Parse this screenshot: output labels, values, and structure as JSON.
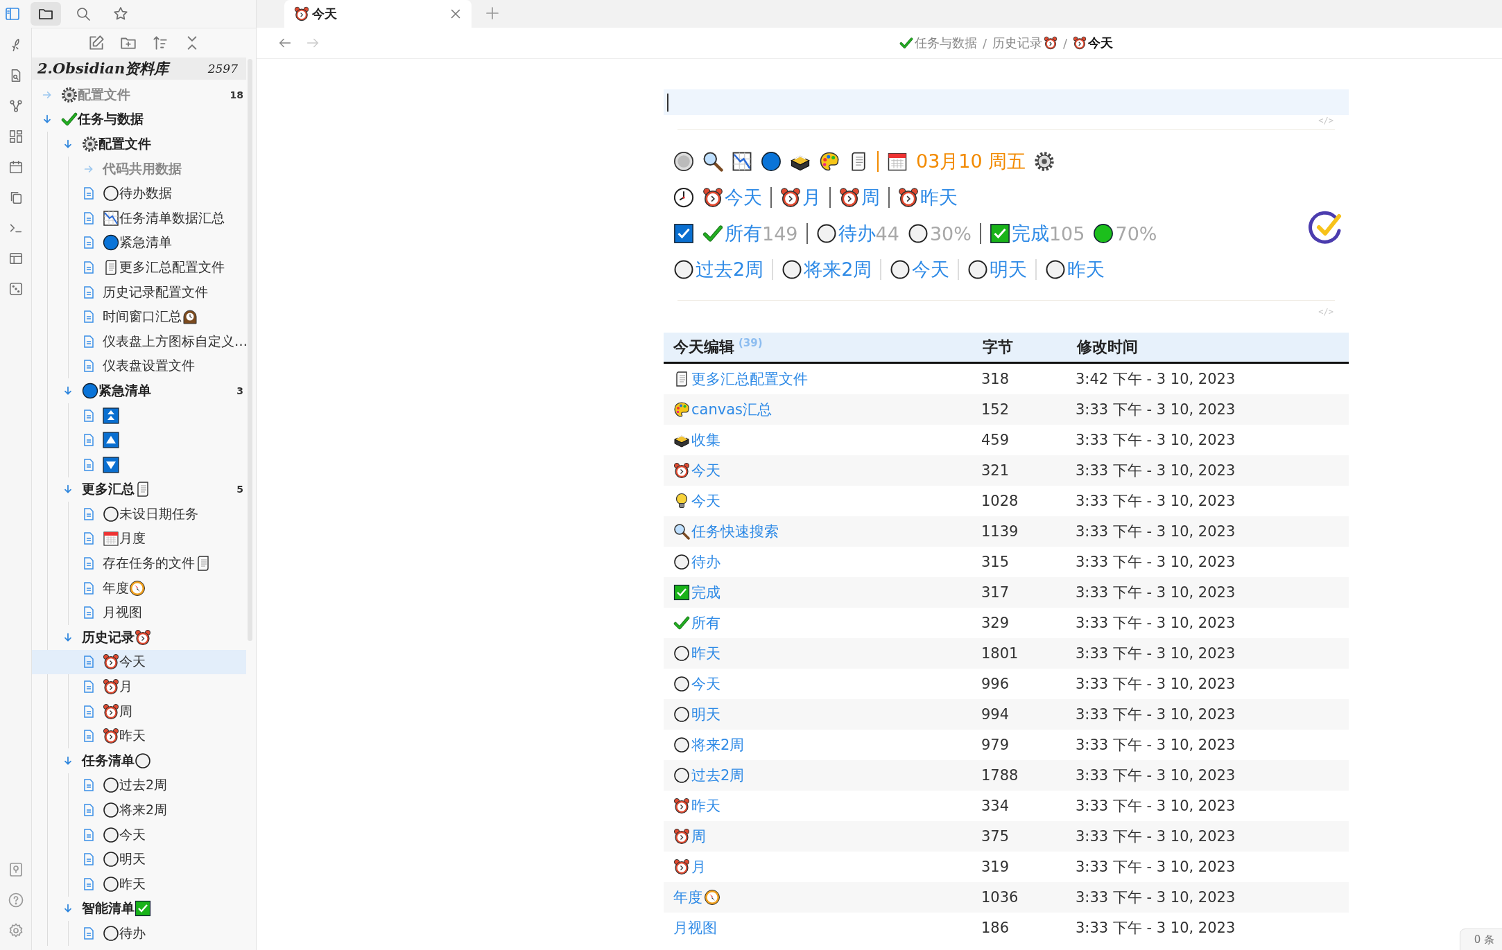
{
  "sidebar_tabs": [
    {
      "kind": "folder",
      "selected": true
    },
    {
      "kind": "search",
      "selected": false
    },
    {
      "kind": "star",
      "selected": false
    }
  ],
  "vault": {
    "name": "2.Obsidian资料库",
    "count": "2597"
  },
  "tree": [
    {
      "kind": "gear",
      "text": "配置文件",
      "count": "18",
      "expanded": false,
      "dimmed": true,
      "selected": false
    },
    {
      "kind": "check",
      "text": "任务与数据",
      "expanded": true,
      "dimmed": false,
      "selected": false,
      "children": [
        {
          "kind": "gear",
          "text": "配置文件",
          "expanded": true,
          "dimmed": false,
          "selected": false,
          "children": [
            {
              "kind": "plain",
              "text": "代码共用数据",
              "expanded": false,
              "dimmed": true,
              "selected": false
            },
            {
              "kind": "circle",
              "text": "待办数据",
              "selected": false
            },
            {
              "kind": "chart",
              "text": "任务清单数据汇总",
              "selected": false
            },
            {
              "kind": "bluedot",
              "text": "紧急清单",
              "selected": false
            },
            {
              "kind": "scroll",
              "text": "更多汇总配置文件",
              "selected": false
            },
            {
              "kind": "plain",
              "text": "历史记录配置文件",
              "selected": false
            },
            {
              "kind": "mantel_after",
              "text": "时间窗口汇总",
              "selected": false
            },
            {
              "kind": "plain",
              "text": "仪表盘上方图标自定义…",
              "selected": false
            },
            {
              "kind": "plain",
              "text": "仪表盘设置文件",
              "selected": false
            }
          ]
        },
        {
          "kind": "bluedot",
          "text": "紧急清单",
          "count": "3",
          "expanded": true,
          "dimmed": false,
          "selected": false,
          "children": [
            {
              "kind": "up2",
              "selected": false
            },
            {
              "kind": "up",
              "selected": false
            },
            {
              "kind": "down",
              "selected": false
            }
          ]
        },
        {
          "kind": "scroll_after",
          "text": "更多汇总",
          "count": "5",
          "expanded": true,
          "dimmed": false,
          "selected": false,
          "children": [
            {
              "kind": "circle",
              "text": "未设日期任务",
              "selected": false
            },
            {
              "kind": "calendar",
              "text": "月度",
              "selected": false
            },
            {
              "kind": "scroll_after",
              "text": "存在任务的文件",
              "selected": false
            },
            {
              "kind": "compass_after",
              "text": "年度",
              "selected": false
            },
            {
              "kind": "plain",
              "text": "月视图",
              "selected": false
            }
          ]
        },
        {
          "kind": "alarm_after",
          "text": "历史记录",
          "expanded": true,
          "dimmed": false,
          "selected": false,
          "children": [
            {
              "kind": "alarm",
              "text": "今天",
              "selected": true
            },
            {
              "kind": "alarm",
              "text": "月",
              "selected": false
            },
            {
              "kind": "alarm",
              "text": "周",
              "selected": false
            },
            {
              "kind": "alarm",
              "text": "昨天",
              "selected": false
            }
          ]
        },
        {
          "kind": "circle_after",
          "text": "任务清单",
          "expanded": true,
          "dimmed": false,
          "selected": false,
          "children": [
            {
              "kind": "circle",
              "text": "过去2周",
              "selected": false
            },
            {
              "kind": "circle",
              "text": "将来2周",
              "selected": false
            },
            {
              "kind": "circle",
              "text": "今天",
              "selected": false
            },
            {
              "kind": "circle",
              "text": "明天",
              "selected": false
            },
            {
              "kind": "circle",
              "text": "昨天",
              "selected": false
            }
          ]
        },
        {
          "kind": "greenbox_after",
          "text": "智能清单",
          "expanded": true,
          "dimmed": false,
          "selected": false,
          "children": [
            {
              "kind": "circle",
              "text": "待办",
              "selected": false
            }
          ]
        }
      ]
    }
  ],
  "tab": {
    "kind": "alarm",
    "title": "今天",
    "selected": true
  },
  "breadcrumb": [
    {
      "kind": "check",
      "text": "任务与数据",
      "current": false
    },
    {
      "kind": "sep",
      "text": "/"
    },
    {
      "kind": "alarm_after",
      "text": "历史记录",
      "current": false
    },
    {
      "kind": "sep",
      "text": "/"
    },
    {
      "kind": "alarm",
      "text": "今天",
      "current": true
    }
  ],
  "input_block": {
    "end_mark": "</>"
  },
  "dashboard": {
    "rows": [
      {
        "items": [
          {
            "kind": "circlegrey"
          },
          {
            "kind": "search"
          },
          {
            "kind": "chart"
          },
          {
            "kind": "bluedot"
          },
          {
            "kind": "inbox"
          },
          {
            "kind": "palette"
          },
          {
            "kind": "scroll"
          },
          {
            "kind": "sep"
          },
          {
            "kind": "calendar"
          },
          {
            "kind": "date",
            "text": "03月10 周五"
          },
          {
            "kind": "gear"
          }
        ]
      },
      {
        "items": [
          {
            "kind": "clock"
          },
          {
            "kind": "alarm",
            "text": "今天"
          },
          {
            "kind": "sep"
          },
          {
            "kind": "alarm",
            "text": "月"
          },
          {
            "kind": "sep"
          },
          {
            "kind": "alarm",
            "text": "周"
          },
          {
            "kind": "sep"
          },
          {
            "kind": "alarm",
            "text": "昨天"
          }
        ]
      },
      {
        "items": [
          {
            "kind": "bluebox"
          },
          {
            "kind": "check",
            "text": "所有",
            "count": "149"
          },
          {
            "kind": "sep"
          },
          {
            "kind": "circle",
            "text": "待办",
            "count": "44"
          },
          {
            "kind": "circle",
            "value": "30%"
          },
          {
            "kind": "sep"
          },
          {
            "kind": "greenbox",
            "text": "完成",
            "count": "105"
          },
          {
            "kind": "greendot",
            "value": "70%"
          }
        ]
      },
      {
        "items": [
          {
            "kind": "circle",
            "text": "过去2周"
          },
          {
            "kind": "sep"
          },
          {
            "kind": "circle",
            "text": "将来2周"
          },
          {
            "kind": "sep"
          },
          {
            "kind": "circle",
            "text": "今天"
          },
          {
            "kind": "sep"
          },
          {
            "kind": "circle",
            "text": "明天"
          },
          {
            "kind": "sep"
          },
          {
            "kind": "circle",
            "text": "昨天"
          }
        ]
      }
    ],
    "end_mark": "</>"
  },
  "table": {
    "columns": [
      {
        "text": "今天编辑",
        "count": "(39)"
      },
      {
        "text": "字节"
      },
      {
        "text": "修改时间"
      }
    ],
    "rows": [
      {
        "kind": "scroll",
        "name": "更多汇总配置文件",
        "bytes": "318",
        "modified": "3:42 下午 - 3 10, 2023"
      },
      {
        "kind": "palette",
        "name": "canvas汇总",
        "bytes": "152",
        "modified": "3:33 下午 - 3 10, 2023"
      },
      {
        "kind": "inbox",
        "name": "收集",
        "bytes": "459",
        "modified": "3:33 下午 - 3 10, 2023"
      },
      {
        "kind": "alarm",
        "name": "今天",
        "bytes": "321",
        "modified": "3:33 下午 - 3 10, 2023"
      },
      {
        "kind": "bulb",
        "name": "今天",
        "bytes": "1028",
        "modified": "3:33 下午 - 3 10, 2023"
      },
      {
        "kind": "search",
        "name": "任务快速搜索",
        "bytes": "1139",
        "modified": "3:33 下午 - 3 10, 2023"
      },
      {
        "kind": "circle",
        "name": "待办",
        "bytes": "315",
        "modified": "3:33 下午 - 3 10, 2023"
      },
      {
        "kind": "greenbox",
        "name": "完成",
        "bytes": "317",
        "modified": "3:33 下午 - 3 10, 2023"
      },
      {
        "kind": "check",
        "name": "所有",
        "bytes": "329",
        "modified": "3:33 下午 - 3 10, 2023"
      },
      {
        "kind": "circle",
        "name": "昨天",
        "bytes": "1801",
        "modified": "3:33 下午 - 3 10, 2023"
      },
      {
        "kind": "circle",
        "name": "今天",
        "bytes": "996",
        "modified": "3:33 下午 - 3 10, 2023"
      },
      {
        "kind": "circle",
        "name": "明天",
        "bytes": "994",
        "modified": "3:33 下午 - 3 10, 2023"
      },
      {
        "kind": "circle",
        "name": "将来2周",
        "bytes": "979",
        "modified": "3:33 下午 - 3 10, 2023"
      },
      {
        "kind": "circle",
        "name": "过去2周",
        "bytes": "1788",
        "modified": "3:33 下午 - 3 10, 2023"
      },
      {
        "kind": "alarm",
        "name": "昨天",
        "bytes": "334",
        "modified": "3:33 下午 - 3 10, 2023"
      },
      {
        "kind": "alarm",
        "name": "周",
        "bytes": "375",
        "modified": "3:33 下午 - 3 10, 2023"
      },
      {
        "kind": "alarm",
        "name": "月",
        "bytes": "319",
        "modified": "3:33 下午 - 3 10, 2023"
      },
      {
        "kind": "compass_after",
        "name": "年度",
        "bytes": "1036",
        "modified": "3:33 下午 - 3 10, 2023"
      },
      {
        "kind": "plain",
        "name": "月视图",
        "bytes": "186",
        "modified": "3:33 下午 - 3 10, 2023"
      }
    ]
  },
  "status": {
    "text": "0 条"
  }
}
